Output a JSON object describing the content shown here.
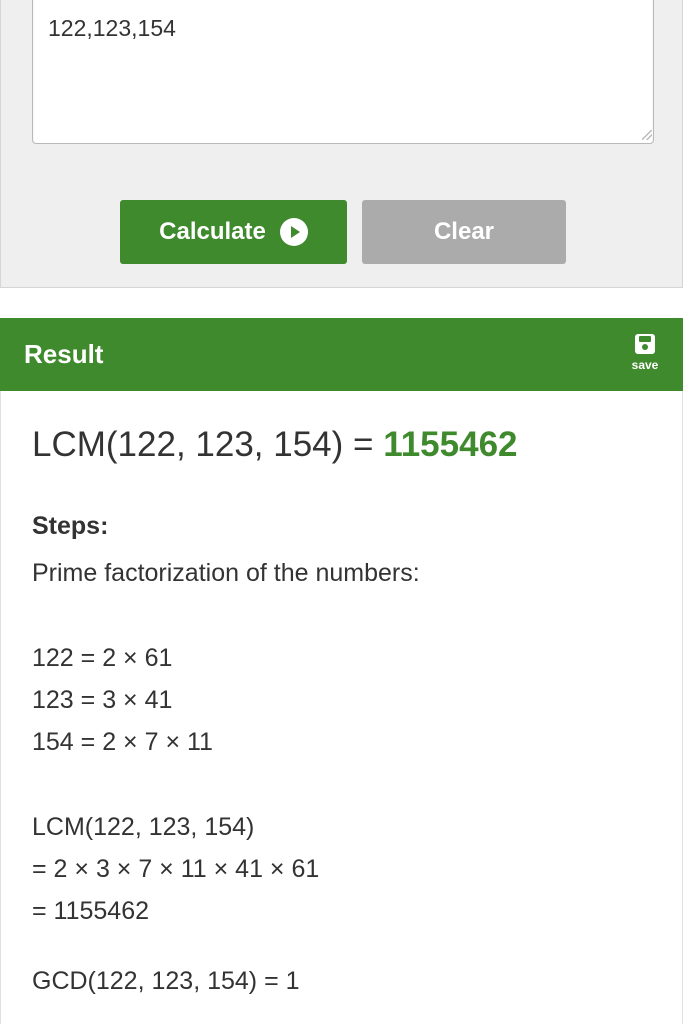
{
  "input": {
    "numbers_value": "122,123,154"
  },
  "buttons": {
    "calculate_label": "Calculate",
    "clear_label": "Clear"
  },
  "result": {
    "title": "Result",
    "save_label": "save",
    "summary_expr": "LCM(122, 123, 154) = ",
    "summary_value": "1155462",
    "steps_label": "Steps:",
    "factorization_heading": "Prime factorization of the numbers:",
    "factorizations": [
      "122 = 2 × 61",
      "123 = 3 × 41",
      "154 = 2 × 7 × 11"
    ],
    "lcm_steps": [
      "LCM(122, 123, 154)",
      "= 2 × 3 × 7 × 11 × 41 × 61",
      "= 1155462"
    ],
    "gcd_line": "GCD(122, 123, 154) = 1"
  },
  "colors": {
    "accent": "#3f8a2d",
    "clear_button": "#ababab",
    "panel_background": "#efefef"
  },
  "icons": {
    "calculate": "play-circle-icon",
    "save": "floppy-disk-icon"
  }
}
